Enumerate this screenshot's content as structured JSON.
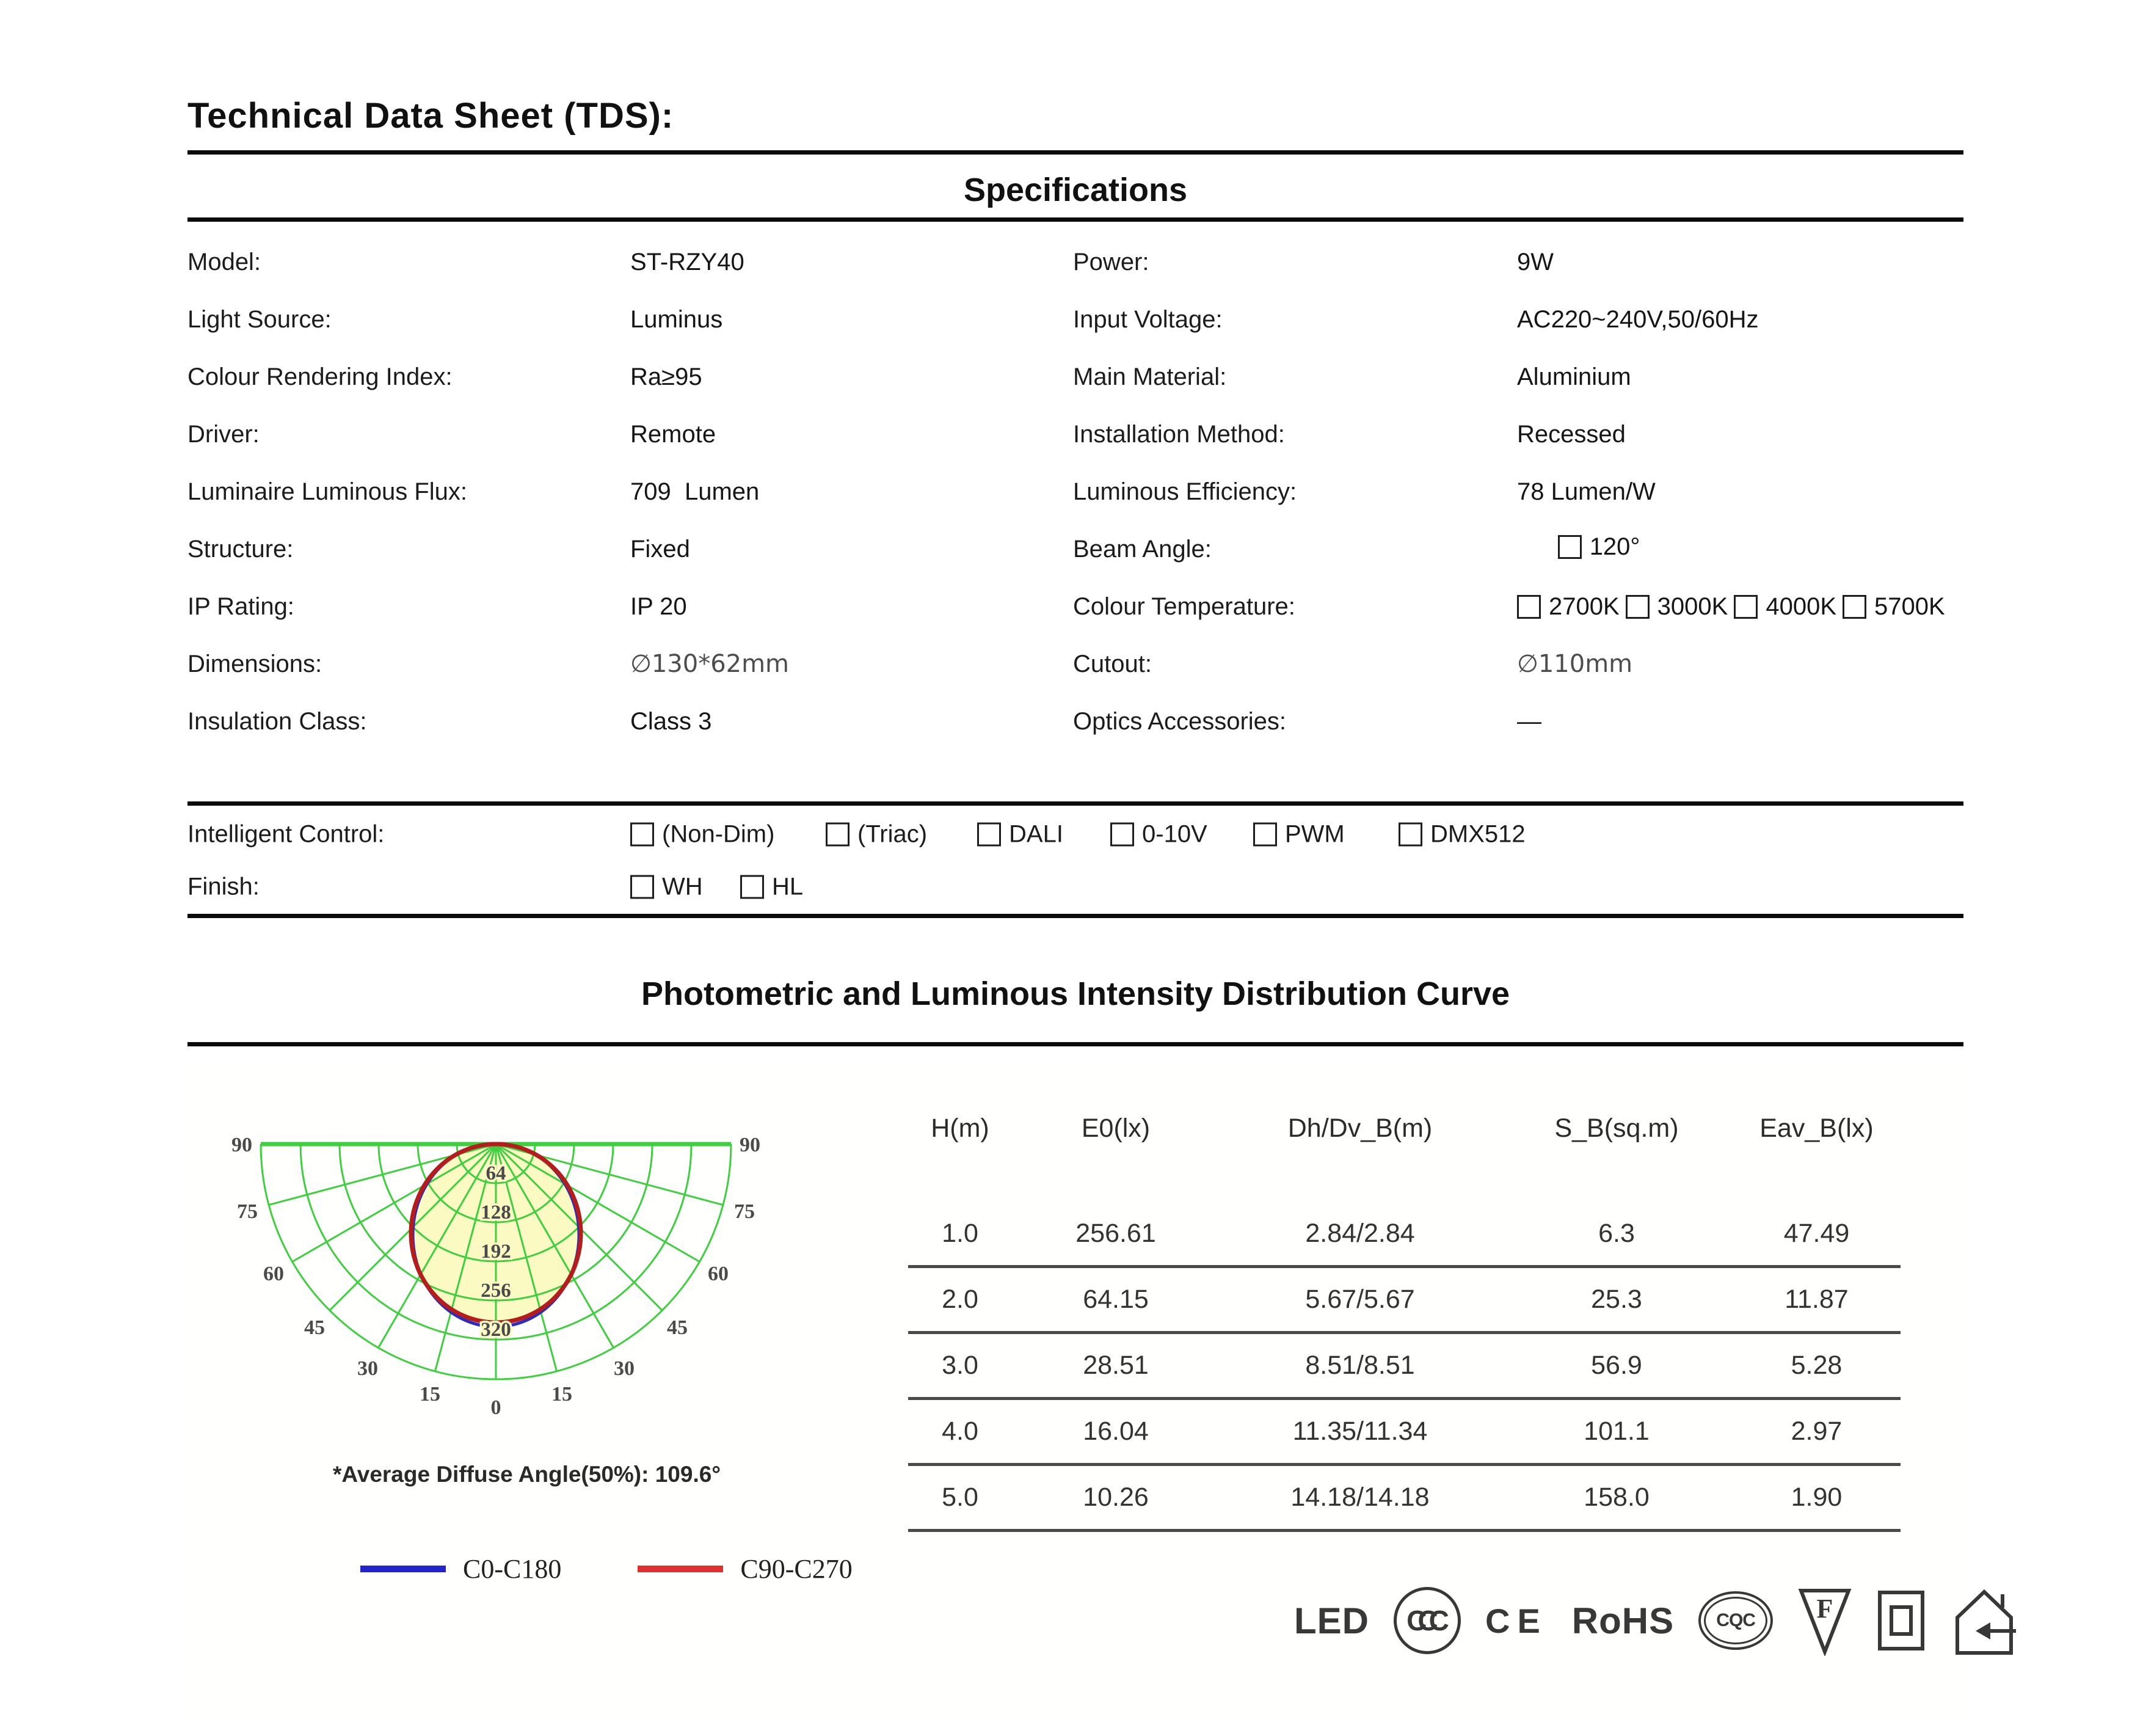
{
  "page": {
    "title": "Technical  Data Sheet (TDS):"
  },
  "specifications": {
    "heading": "Specifications",
    "rows": [
      {
        "l_label": "Model:",
        "l_value": "ST-RZY40",
        "r_label": "Power:",
        "r_value": "9W"
      },
      {
        "l_label": "Light Source:",
        "l_value": "Luminus",
        "r_label": "Input Voltage:",
        "r_value": "AC220~240V,50/60Hz"
      },
      {
        "l_label": "Colour Rendering Index:",
        "l_value": "Ra≥95",
        "r_label": "Main Material:",
        "r_value": "Aluminium"
      },
      {
        "l_label": "Driver:",
        "l_value": "Remote",
        "r_label": "Installation Method:",
        "r_value": "Recessed"
      },
      {
        "l_label": "Luminaire Luminous Flux:",
        "l_value": "709  Lumen",
        "r_label": "Luminous Efficiency:",
        "r_value": "78 Lumen/W"
      },
      {
        "l_label": "Structure:",
        "l_value": "Fixed",
        "r_label": "Beam Angle:",
        "r_value": "120°"
      },
      {
        "l_label": "IP Rating:",
        "l_value": "IP 20",
        "r_label": "Colour Temperature:",
        "r_options": [
          "2700K",
          "3000K",
          "4000K",
          "5700K"
        ]
      },
      {
        "l_label": "Dimensions:",
        "l_value": "∅130*62mm",
        "r_label": "Cutout:",
        "r_value": "∅110mm"
      },
      {
        "l_label": "Insulation Class:",
        "l_value": "Class 3",
        "r_label": "Optics Accessories:",
        "r_value": "—"
      }
    ],
    "intelligent_control": {
      "label": "Intelligent Control:",
      "options": [
        "(Non-Dim)",
        "(Triac)",
        "DALI",
        "0-10V",
        "PWM",
        "DMX512"
      ]
    },
    "finish": {
      "label": "Finish:",
      "options": [
        "WH",
        "HL"
      ]
    }
  },
  "photometric": {
    "heading": "Photometric and Luminous Intensity Distribution Curve",
    "avg_note": "*Average Diffuse Angle(50%): 109.6°",
    "legend": [
      {
        "label": "C0-C180",
        "color": "#2323cb"
      },
      {
        "label": "C90-C270",
        "color": "#e03030"
      }
    ],
    "chart": {
      "rings": [
        "64",
        "128",
        "192",
        "256",
        "320"
      ],
      "angles": [
        "90",
        "75",
        "60",
        "45",
        "30",
        "15"
      ],
      "zero_label": "0",
      "grid_color": "#3ecf3e",
      "fill_color": "#fbfac2",
      "c90_color": "#b51c1c",
      "c0_color": "#2b2bc0"
    },
    "table": {
      "headers": [
        "H(m)",
        "E0(lx)",
        "Dh/Dv_B(m)",
        "S_B(sq.m)",
        "Eav_B(lx)"
      ],
      "rows": [
        [
          "1.0",
          "256.61",
          "2.84/2.84",
          "6.3",
          "47.49"
        ],
        [
          "2.0",
          "64.15",
          "5.67/5.67",
          "25.3",
          "11.87"
        ],
        [
          "3.0",
          "28.51",
          "8.51/8.51",
          "56.9",
          "5.28"
        ],
        [
          "4.0",
          "16.04",
          "11.35/11.34",
          "101.1",
          "2.97"
        ],
        [
          "5.0",
          "10.26",
          "14.18/14.18",
          "158.0",
          "1.90"
        ]
      ]
    },
    "logos": {
      "led": "LED",
      "ccc": "CCC",
      "ce": "CE",
      "rohs": "RoHS",
      "cqc": "CQC",
      "f_mark": "F"
    }
  },
  "chart_data": {
    "type": "polar-intensity",
    "title": "Photometric and Luminous Intensity Distribution Curve",
    "angle_ticks_deg": [
      0,
      15,
      30,
      45,
      60,
      75,
      90
    ],
    "intensity_rings_cd": [
      64,
      128,
      192,
      256,
      320
    ],
    "series": [
      {
        "name": "C0-C180",
        "color": "#2323cb"
      },
      {
        "name": "C90-C270",
        "color": "#e03030"
      }
    ],
    "peak_intensity_cd_at_0deg": 290,
    "beam_half_width_cd": 138,
    "average_diffuse_angle_50pct_deg": 109.6,
    "grid": "green semicircular polar grid, spokes every 15°",
    "companion_table": {
      "headers": [
        "H(m)",
        "E0(lx)",
        "Dh/Dv_B(m)",
        "S_B(sq.m)",
        "Eav_B(lx)"
      ],
      "rows": [
        [
          1.0,
          256.61,
          "2.84/2.84",
          6.3,
          47.49
        ],
        [
          2.0,
          64.15,
          "5.67/5.67",
          25.3,
          11.87
        ],
        [
          3.0,
          28.51,
          "8.51/8.51",
          56.9,
          5.28
        ],
        [
          4.0,
          16.04,
          "11.35/11.34",
          101.1,
          2.97
        ],
        [
          5.0,
          10.26,
          "14.18/14.18",
          158.0,
          1.9
        ]
      ]
    }
  }
}
